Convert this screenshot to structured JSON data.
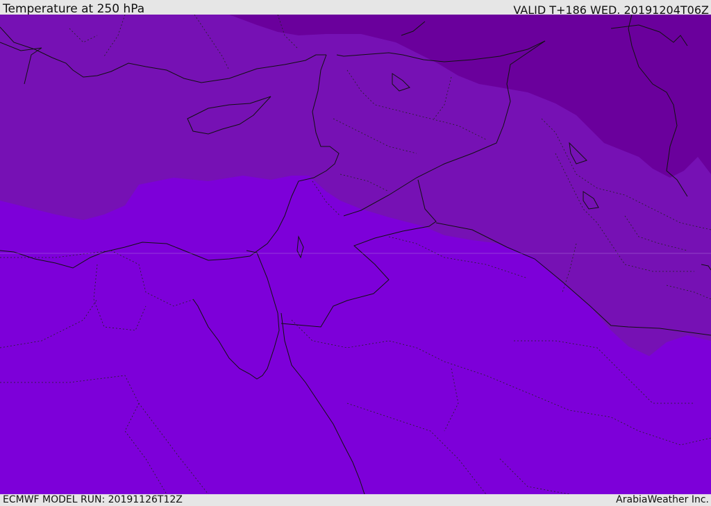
{
  "header": {
    "title": "Temperature at 250 hPa",
    "valid": "VALID T+186 WED. 20191204T06Z"
  },
  "footer": {
    "model_run": "ECMWF MODEL RUN: 20191126T12Z",
    "credit": "ArabiaWeather Inc."
  },
  "colors": {
    "band_warm": "#7d00d9",
    "band_mid": "#7611b4",
    "band_cold": "#6a009c",
    "outline": "#111111"
  }
}
